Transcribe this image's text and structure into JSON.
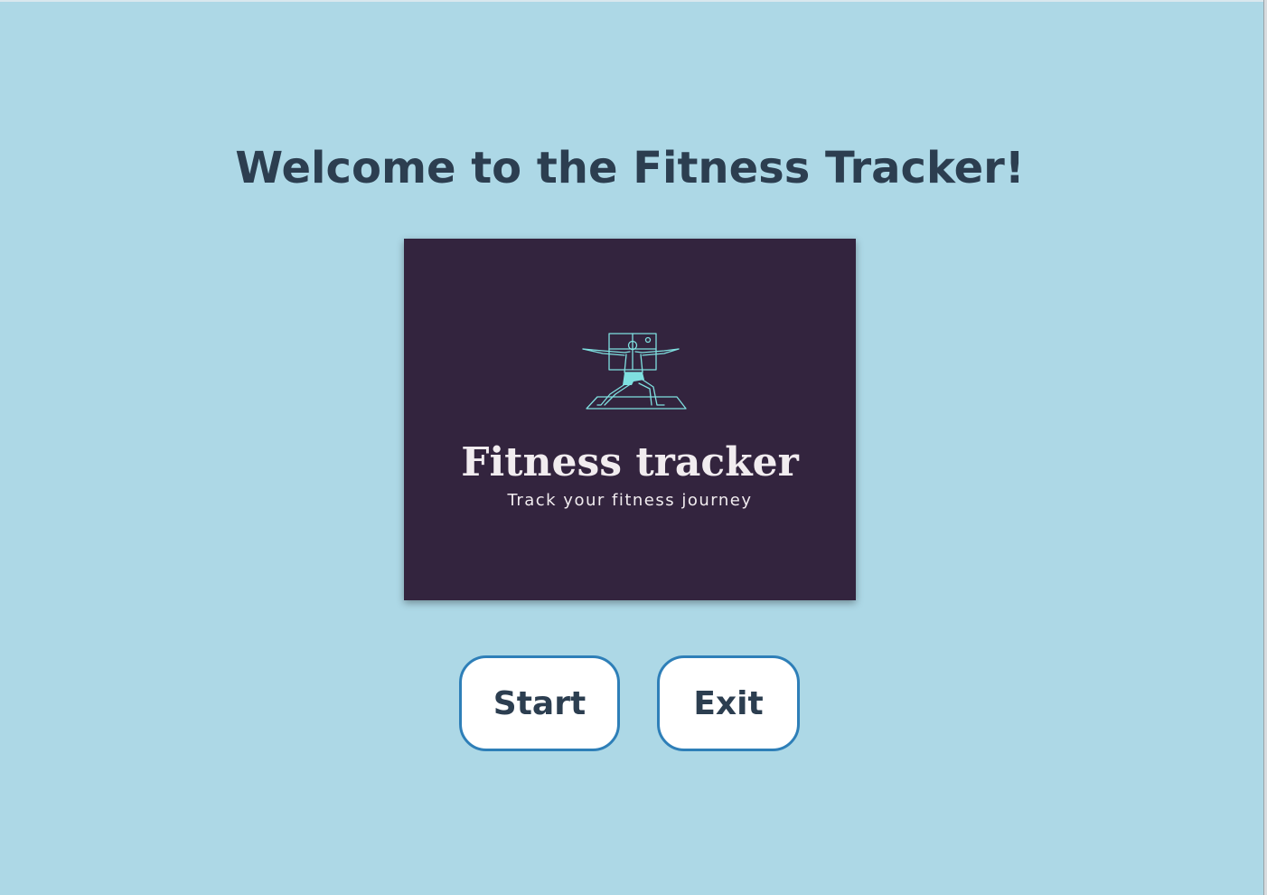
{
  "welcome": {
    "title": "Welcome to the Fitness Tracker!"
  },
  "logo": {
    "wordmark": "Fitness tracker",
    "tagline": "Track your fitness journey",
    "icon": "yoga-warrior-pose-icon",
    "colors": {
      "background": "#33243e",
      "line": "#7fe0e0",
      "text": "#f1ecef"
    }
  },
  "actions": {
    "start_label": "Start",
    "exit_label": "Exit"
  },
  "colors": {
    "page_background": "#add8e6",
    "title": "#2c3e50",
    "button_border": "#2e7fb8",
    "button_background": "#ffffff"
  }
}
